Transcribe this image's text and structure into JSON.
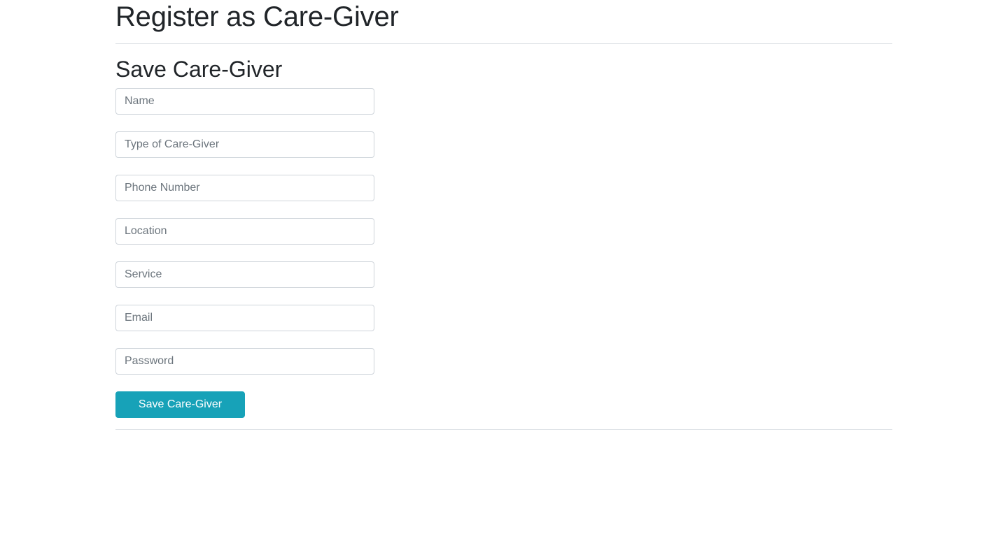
{
  "page": {
    "title": "Register as Care-Giver"
  },
  "form": {
    "heading": "Save Care-Giver",
    "fields": {
      "name": {
        "placeholder": "Name",
        "value": ""
      },
      "type": {
        "placeholder": "Type of Care-Giver",
        "value": ""
      },
      "phone": {
        "placeholder": "Phone Number",
        "value": ""
      },
      "location": {
        "placeholder": "Location",
        "value": ""
      },
      "service": {
        "placeholder": "Service",
        "value": ""
      },
      "email": {
        "placeholder": "Email",
        "value": ""
      },
      "password": {
        "placeholder": "Password",
        "value": ""
      }
    },
    "submit_label": "Save Care-Giver"
  },
  "colors": {
    "button_bg": "#17a2b8",
    "button_text": "#ffffff",
    "text": "#212529",
    "placeholder": "#6c757d",
    "border": "#ced4da",
    "divider": "#dee2e6"
  }
}
